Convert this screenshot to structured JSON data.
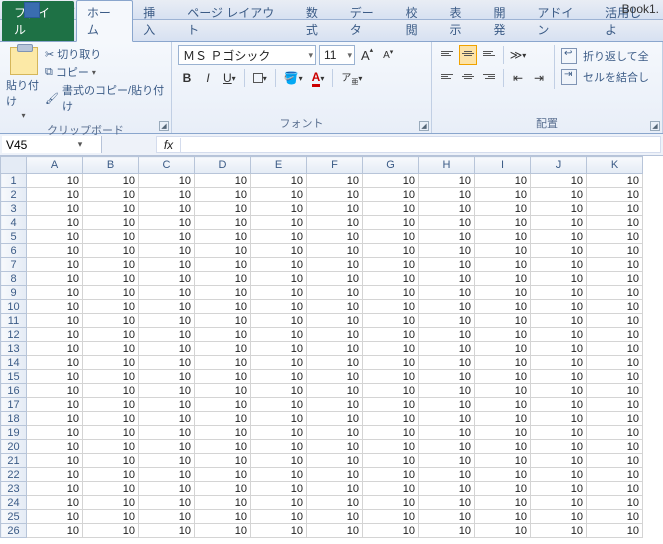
{
  "titlebar": {
    "doc_name": "Book1."
  },
  "tabs": {
    "file": "ファイル",
    "items": [
      "ホーム",
      "挿入",
      "ページ レイアウト",
      "数式",
      "データ",
      "校閲",
      "表示",
      "開発",
      "アドイン",
      "活用しよ"
    ],
    "active_index": 0
  },
  "clipboard": {
    "paste": "貼り付け",
    "cut": "切り取り",
    "copy": "コピー",
    "format_painter": "書式のコピー/貼り付け",
    "label": "クリップボード"
  },
  "font": {
    "name": "ＭＳ Ｐゴシック",
    "size": "11",
    "grow": "A",
    "shrink": "A",
    "bold": "B",
    "italic": "I",
    "underline": "U",
    "label": "フォント"
  },
  "alignment": {
    "wrap": "折り返して全",
    "merge": "セルを結合し",
    "label": "配置"
  },
  "formula_bar": {
    "name_box": "V45",
    "fx": "fx",
    "value": ""
  },
  "grid": {
    "columns": [
      "A",
      "B",
      "C",
      "D",
      "E",
      "F",
      "G",
      "H",
      "I",
      "J",
      "K"
    ],
    "row_count": 26,
    "cell_value": "10"
  }
}
